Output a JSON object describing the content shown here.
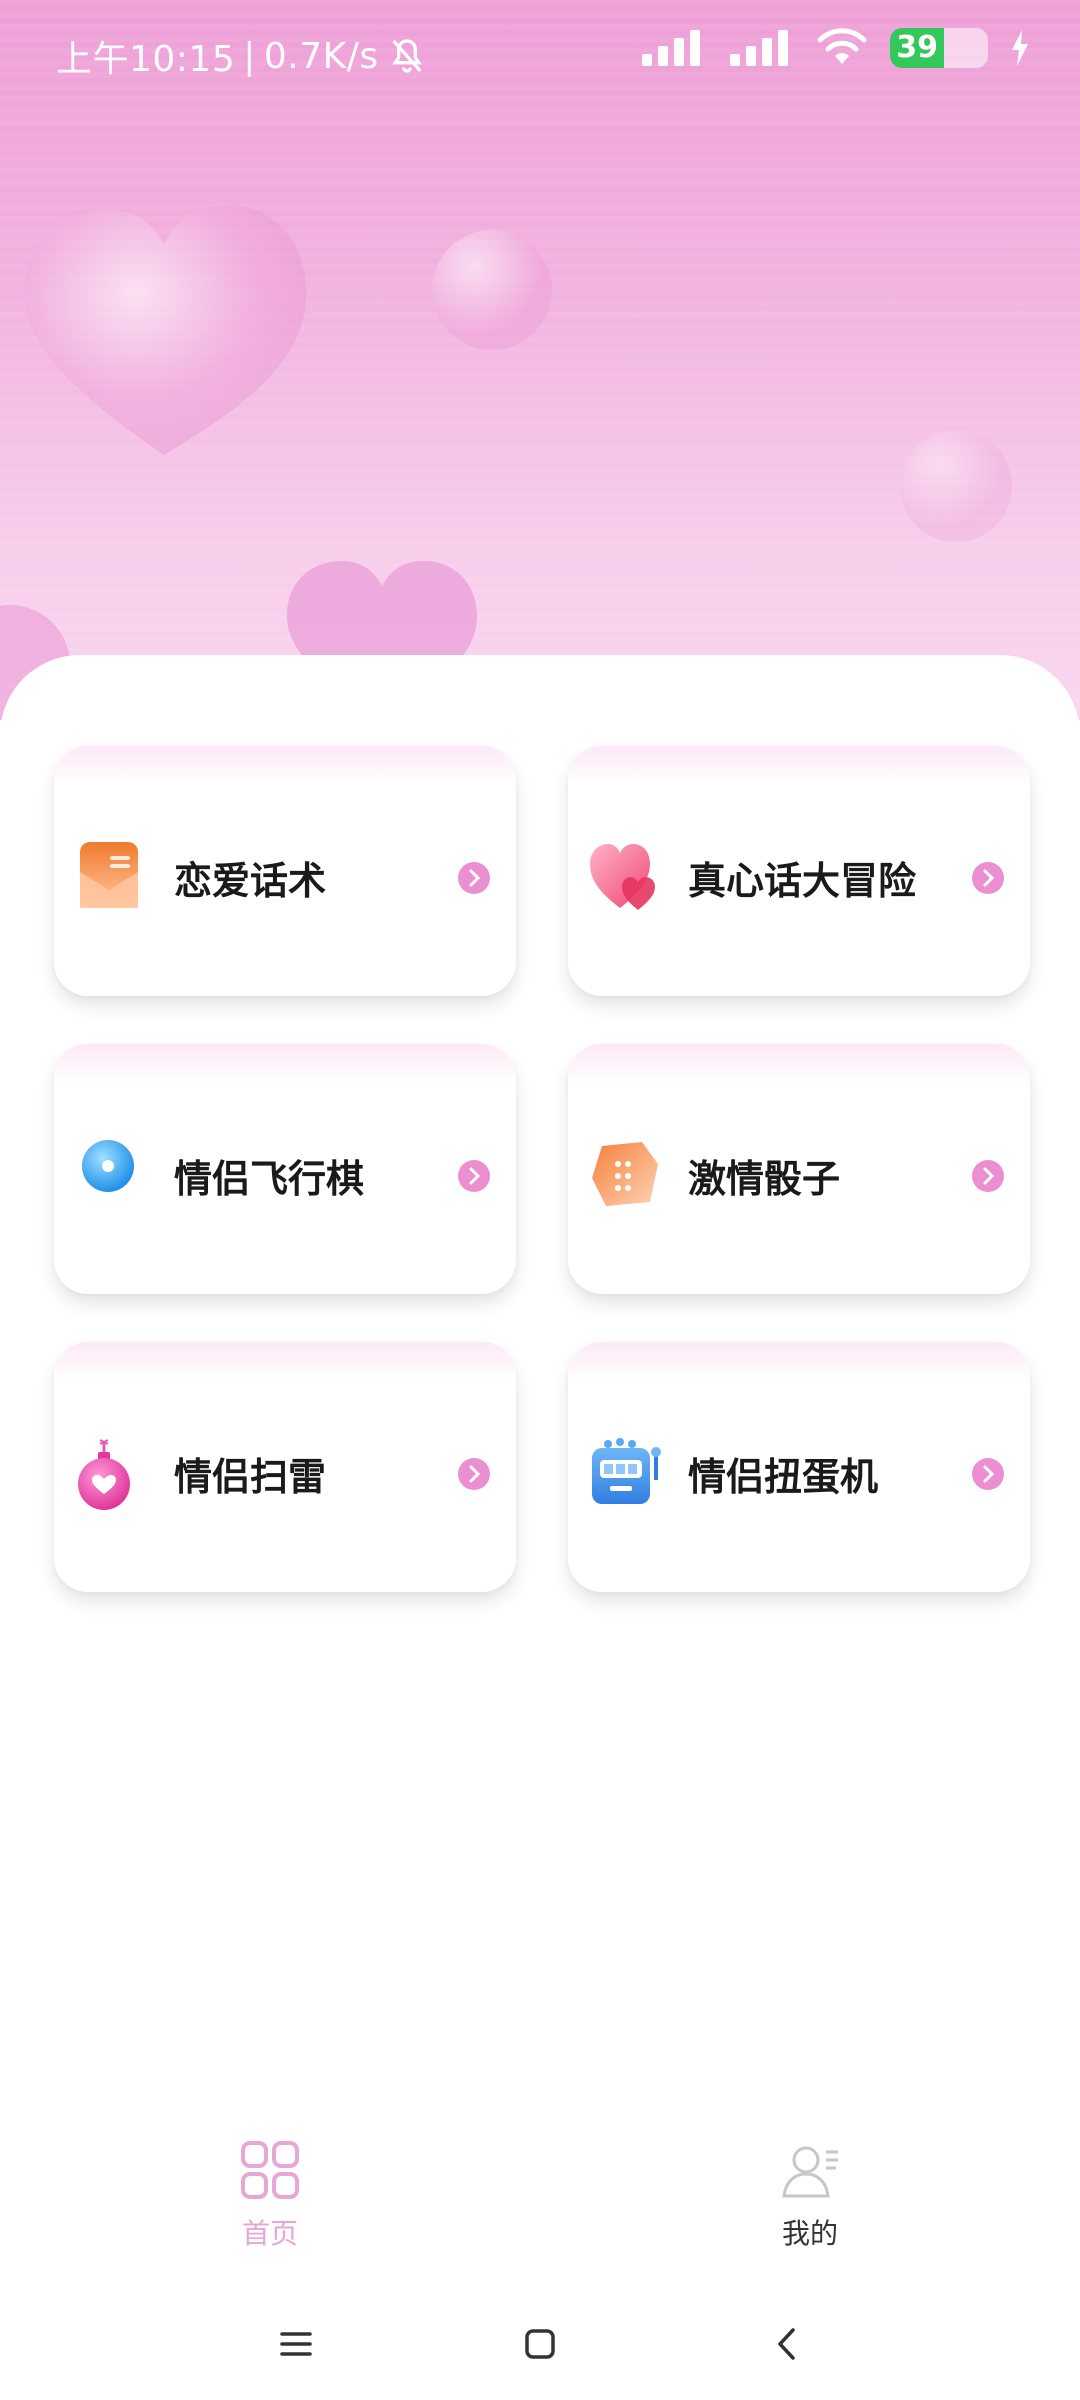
{
  "status_bar": {
    "time": "上午10:15",
    "separator": "|",
    "net_speed": "0.7K/s",
    "battery_level": "39",
    "icons": [
      "bell-muted-icon",
      "signal-icon",
      "signal-icon",
      "wifi-icon",
      "battery-icon",
      "charging-icon"
    ]
  },
  "cards": [
    {
      "label": "恋爱话术",
      "icon": "envelope-icon",
      "arrow": "chevron-right-icon"
    },
    {
      "label": "真心话大冒险",
      "icon": "hearts-icon",
      "arrow": "chevron-right-icon"
    },
    {
      "label": "情侣飞行棋",
      "icon": "game-disc-icon",
      "arrow": "chevron-right-icon"
    },
    {
      "label": "激情骰子",
      "icon": "dice-icon",
      "arrow": "chevron-right-icon"
    },
    {
      "label": "情侣扫雷",
      "icon": "heart-bomb-icon",
      "arrow": "chevron-right-icon"
    },
    {
      "label": "情侣扭蛋机",
      "icon": "slot-machine-icon",
      "arrow": "chevron-right-icon"
    }
  ],
  "tabbar": {
    "home_label": "首页",
    "mine_label": "我的",
    "active": "首页",
    "active_color": "#e8a6d6"
  },
  "navbar": {
    "icons": [
      "menu-icon",
      "home-square-icon",
      "back-icon"
    ]
  },
  "colors": {
    "hero_top": "#ee9fd6",
    "hero_bottom": "#f9d6ef",
    "arrow_pink": "#ec8fd0"
  }
}
